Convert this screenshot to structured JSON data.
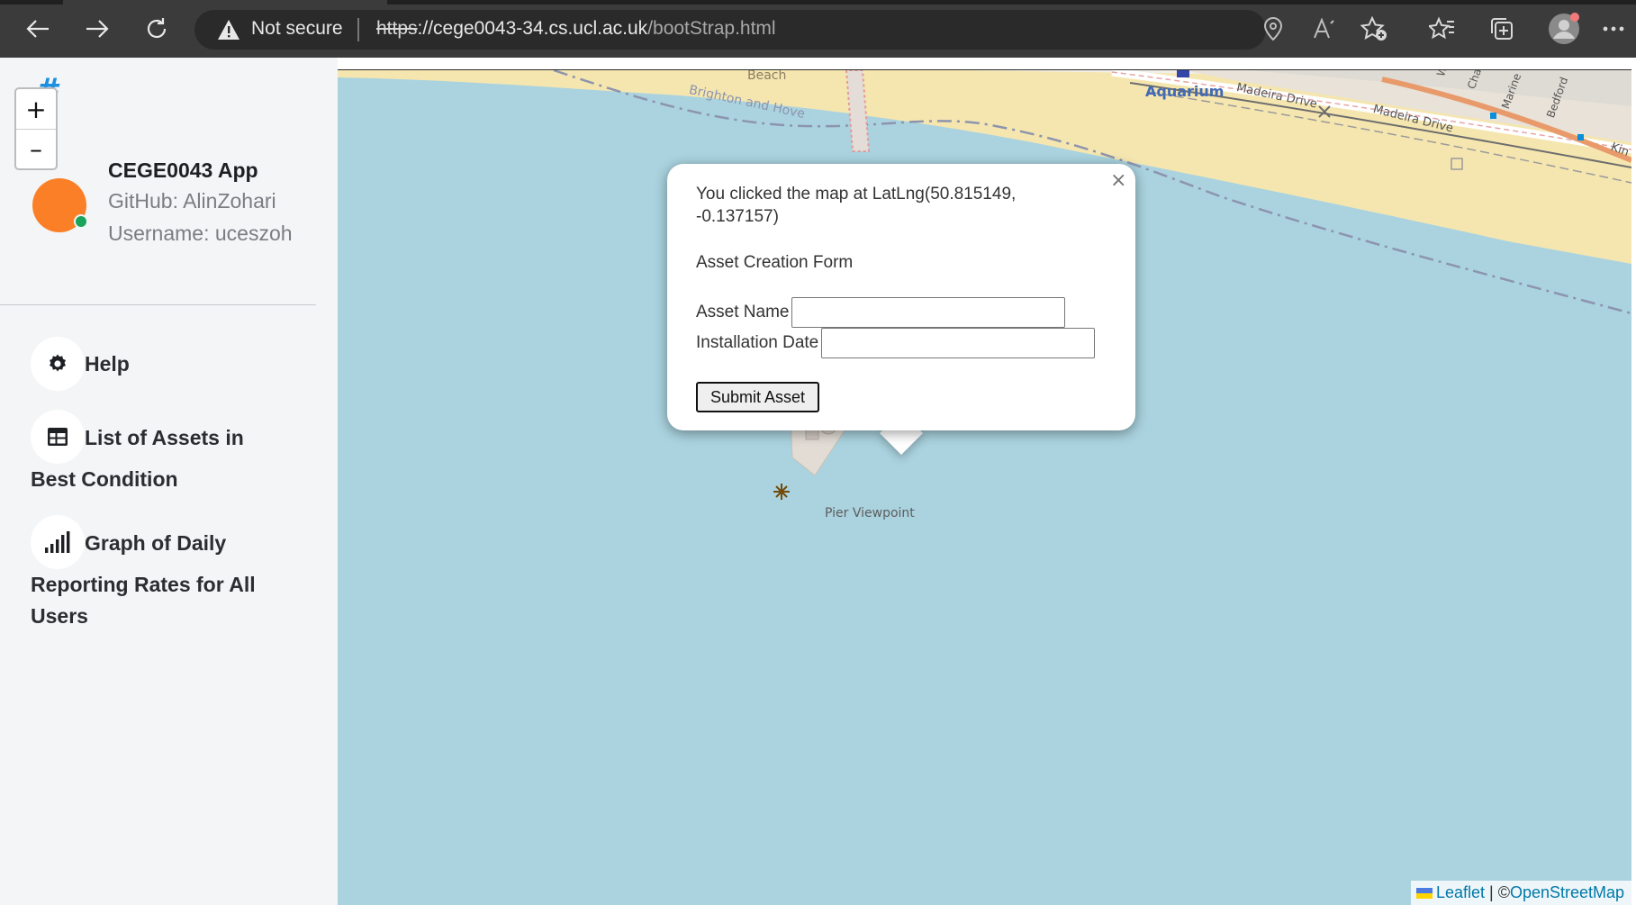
{
  "browser": {
    "security_label": "Not secure",
    "url_scheme": "https",
    "url_host": "://cege0043-34.cs.ucl.ac.uk",
    "url_path": "/bootStrap.html",
    "icons": [
      "back-arrow-icon",
      "forward-arrow-icon",
      "refresh-icon",
      "warning-icon",
      "location-icon",
      "read-aloud-icon",
      "add-favorite-icon",
      "favorites-icon",
      "collections-icon",
      "profile-icon",
      "more-icon"
    ]
  },
  "sidebar": {
    "app_title": "CEGE0043 App",
    "github": "GitHub: AlinZohari",
    "username": "Username: uceszoh",
    "menu": [
      {
        "icon": "gear-icon",
        "label": "Help"
      },
      {
        "icon": "table-icon",
        "label_line1": "List of Assets in",
        "label_line2": "Best Condition"
      },
      {
        "icon": "signal-bars-icon",
        "label_line1": "Graph of Daily",
        "label_line2": "Reporting Rates for All",
        "label_line3": "Users"
      }
    ]
  },
  "map": {
    "zoom_in": "+",
    "zoom_out": "–",
    "labels": {
      "beach": "Beach",
      "brighton": "Brighton and Hove",
      "aquarium": "Aquarium",
      "madeira1": "Madeira Drive",
      "madeira2": "Madeira Drive",
      "pier_viewpoint": "Pier Viewpoint",
      "road1": "Wyn",
      "road2": "Char",
      "road3": "Marine",
      "road4": "Bedford",
      "road5": "Kin"
    },
    "colors": {
      "water": "#aad3df",
      "sand": "#f6e9b5",
      "land": "#f2efe9"
    }
  },
  "popup": {
    "clicked_line1": "You clicked the map at LatLng(50.815149,",
    "clicked_line2": "-0.137157)",
    "form_title": "Asset Creation Form",
    "asset_name_label": "Asset Name",
    "asset_name_value": "",
    "installation_date_label": "Installation Date",
    "installation_date_value": "",
    "submit_label": "Submit Asset",
    "close_label": "×"
  },
  "attribution": {
    "leaflet": "Leaflet",
    "separator": " | ©",
    "osm": "OpenStreetMap"
  }
}
